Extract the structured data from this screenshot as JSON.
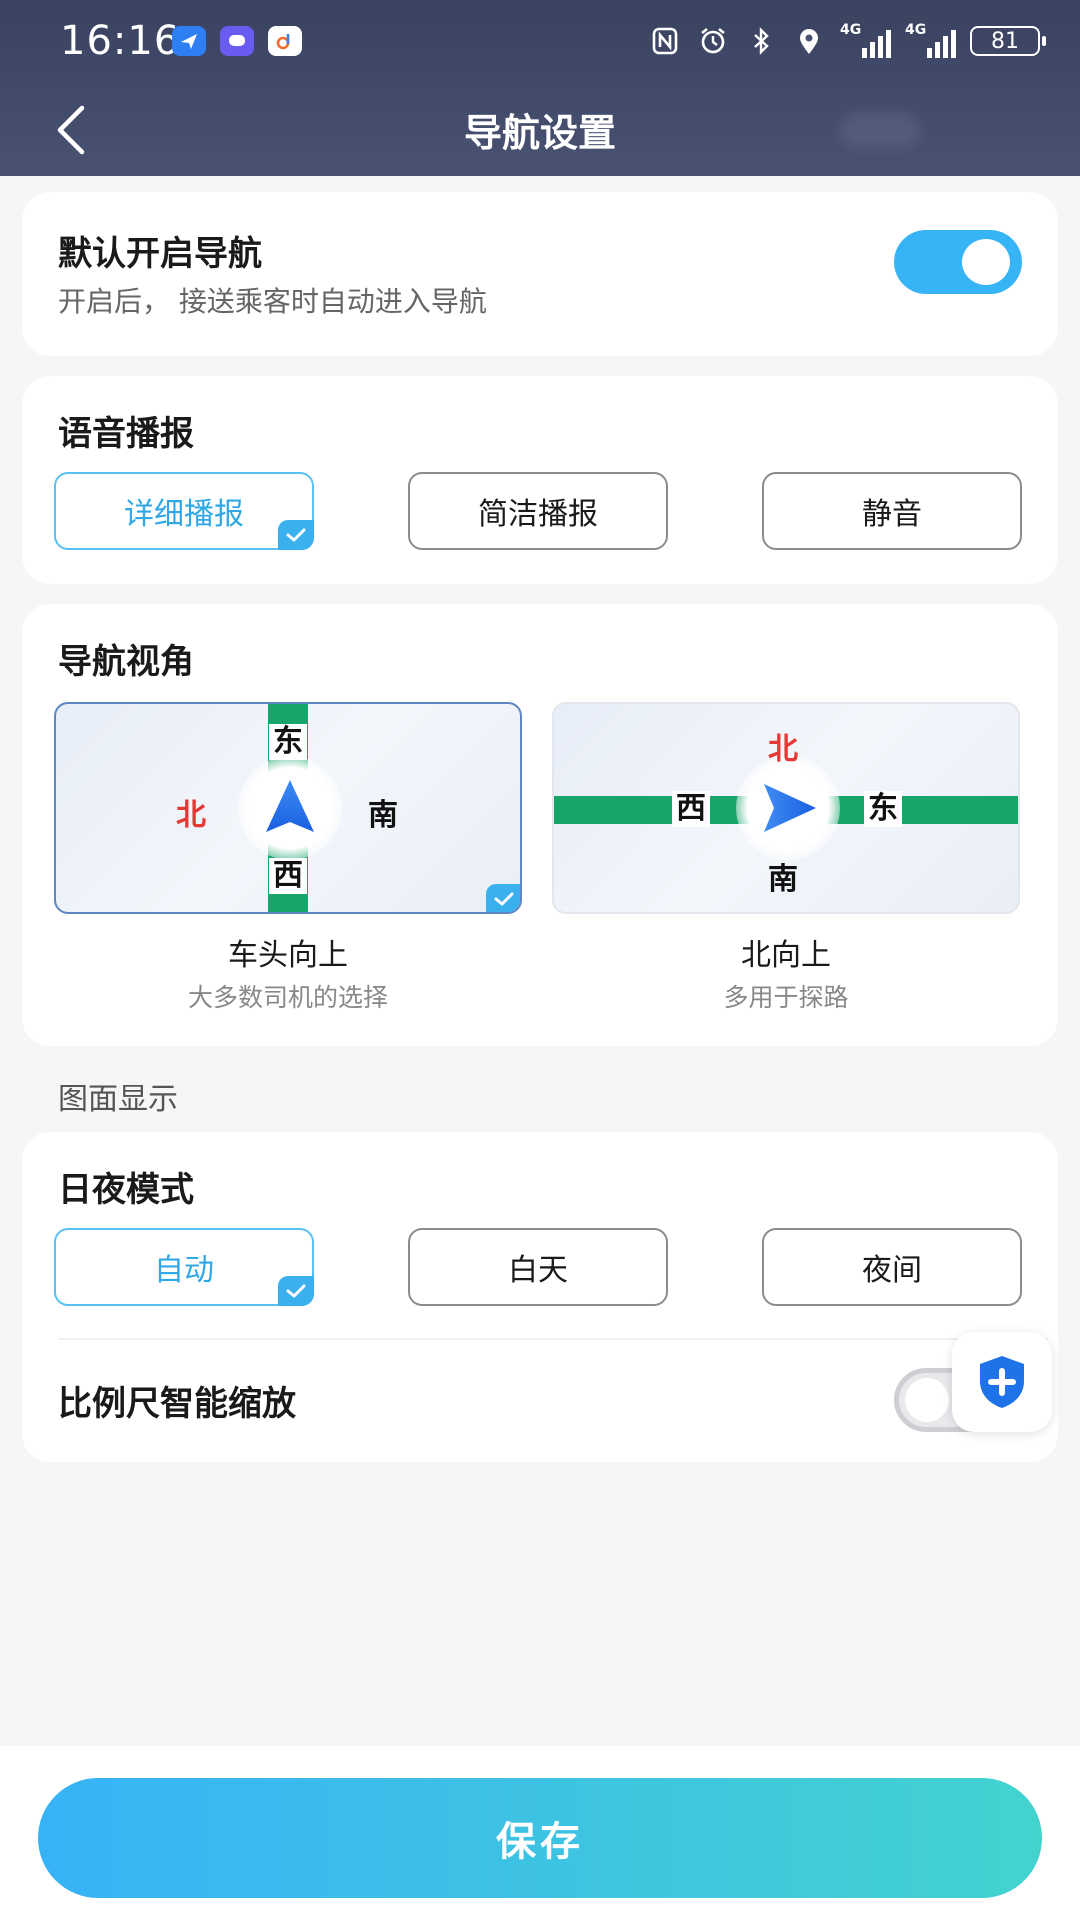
{
  "status_bar": {
    "time": "16:16",
    "signal1_label": "4G",
    "signal2_label": "4G",
    "battery": "81"
  },
  "header": {
    "title": "导航设置"
  },
  "default_nav": {
    "title": "默认开启导航",
    "subtitle": "开启后， 接送乘客时自动进入导航",
    "enabled": true
  },
  "voice": {
    "title": "语音播报",
    "options": [
      "详细播报",
      "简洁播报",
      "静音"
    ],
    "selected": "详细播报"
  },
  "nav_view": {
    "title": "导航视角",
    "options": [
      {
        "label": "车头向上",
        "sub": "大多数司机的选择",
        "dirs": {
          "top": "东",
          "left": "北",
          "right": "南",
          "bottom": "西"
        }
      },
      {
        "label": "北向上",
        "sub": "多用于探路",
        "dirs": {
          "top": "北",
          "left": "西",
          "right": "东",
          "bottom": "南"
        }
      }
    ],
    "selected": "车头向上"
  },
  "display_section": {
    "label": "图面显示"
  },
  "day_night": {
    "title": "日夜模式",
    "options": [
      "自动",
      "白天",
      "夜间"
    ],
    "selected": "自动"
  },
  "scale_zoom": {
    "title": "比例尺智能缩放",
    "enabled": false
  },
  "footer": {
    "save_label": "保存"
  },
  "colors": {
    "accent": "#36b4f5",
    "road": "#17a56a",
    "north_red": "#e53935"
  },
  "icons": {
    "back": "chevron-left-icon",
    "check": "checkmark-icon",
    "shield": "shield-plus-icon"
  }
}
